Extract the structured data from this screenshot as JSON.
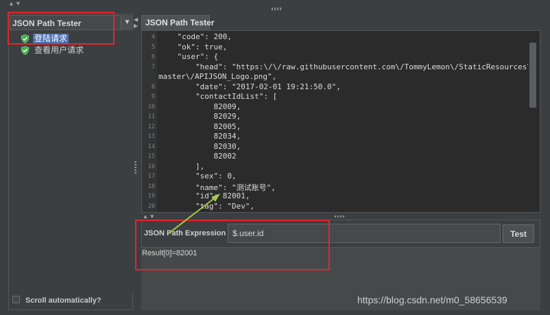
{
  "sidebar": {
    "title": "JSON Path Tester",
    "items": [
      {
        "label": "登陆请求",
        "selected": true
      },
      {
        "label": "查看用户请求",
        "selected": false
      }
    ],
    "scroll_automatically": "Scroll automatically?"
  },
  "tab": {
    "label": "JSON Path Tester"
  },
  "editor": {
    "lines": [
      {
        "n": "4",
        "text": "    \"code\": 200,"
      },
      {
        "n": "5",
        "text": "    \"ok\": true,"
      },
      {
        "n": "6",
        "text": "    \"user\": {"
      },
      {
        "n": "7",
        "text": "        \"head\": \"https:\\/\\/raw.githubusercontent.com\\/TommyLemon\\/StaticResources\\/"
      },
      {
        "n": "",
        "text": "master\\/APIJSON_Logo.png\","
      },
      {
        "n": "8",
        "text": "        \"date\": \"2017-02-01 19:21:50.0\","
      },
      {
        "n": "9",
        "text": "        \"contactIdList\": ["
      },
      {
        "n": "10",
        "text": "            82009,"
      },
      {
        "n": "11",
        "text": "            82029,"
      },
      {
        "n": "12",
        "text": "            82005,"
      },
      {
        "n": "13",
        "text": "            82034,"
      },
      {
        "n": "14",
        "text": "            82030,"
      },
      {
        "n": "15",
        "text": "            82002"
      },
      {
        "n": "16",
        "text": "        ],"
      },
      {
        "n": "17",
        "text": "        \"sex\": 0,"
      },
      {
        "n": "18",
        "text": "        \"name\": \"测试账号\","
      },
      {
        "n": "19",
        "text": "        \"id\": 82001,"
      },
      {
        "n": "20",
        "text": "        \"tag\": \"Dev\","
      }
    ]
  },
  "expression": {
    "label": "JSON Path Expression",
    "value": "$.user.id",
    "test_label": "Test"
  },
  "result": {
    "text": "Result[0]=82001"
  },
  "watermark": "https://blog.csdn.net/m0_58656539",
  "colors": {
    "annotation": "#e8242b",
    "arrow": "#a6c84c",
    "selection": "#4b6eaf"
  },
  "icons": [
    "shield-check-icon",
    "dropdown-arrow-icon"
  ]
}
